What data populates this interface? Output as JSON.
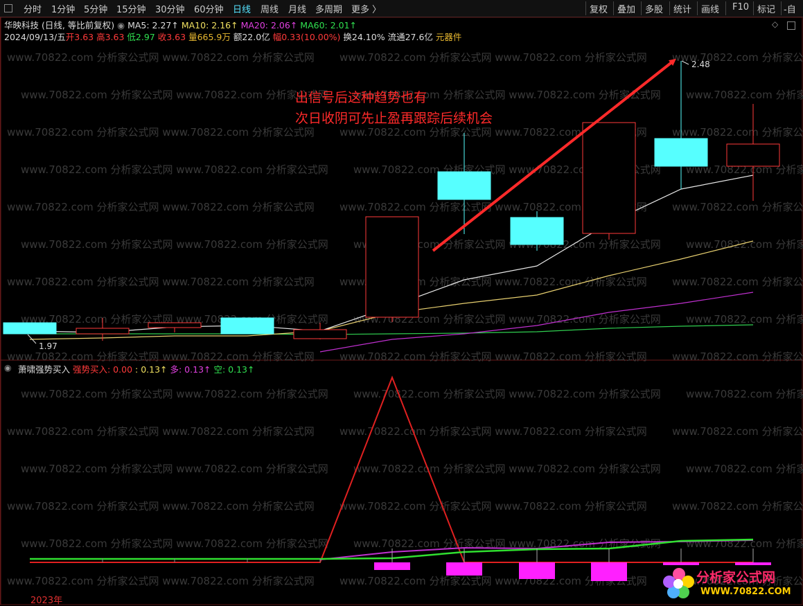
{
  "toolbar": {
    "periods": [
      "分时",
      "1分钟",
      "5分钟",
      "15分钟",
      "30分钟",
      "60分钟",
      "日线",
      "周线",
      "月线",
      "多周期",
      "更多 〉"
    ],
    "active": "日线",
    "right": [
      "复权",
      "叠加",
      "多股",
      "统计",
      "画线",
      "F10",
      "标记",
      "-自"
    ]
  },
  "header": {
    "stock": "华映科技 (日线, 等比前复权)",
    "ma5": "MA5: 2.27↑",
    "ma10": "MA10: 2.16↑",
    "ma20": "MA20: 2.06↑",
    "ma60": "MA60: 2.01↑",
    "date": "2024/09/13/五",
    "open": "开3.63",
    "high": "高3.63",
    "low": "低2.97",
    "close": "收3.63",
    "volume": "量665.9万",
    "amount": "额22.0亿",
    "change": "幅0.33(10.00%)",
    "turnover": "换24.10%",
    "float": "流通27.6亿",
    "sector": "元器件"
  },
  "annotation": {
    "line1": "出信号后这种趋势也有",
    "line2": "次日收阴可先止盈再跟踪后续机会"
  },
  "price_labels": {
    "high": "2.48",
    "low": "1.97"
  },
  "indicator": {
    "name": "萧啸强势买入",
    "signal": "强势买入: 0.00",
    "value1": ": 0.13↑",
    "bull": "多: 0.13↑",
    "bear": "空: 0.13↑"
  },
  "footer": {
    "year": "2023年"
  },
  "watermark": "www.70822.com 分析家公式网",
  "logo": {
    "name": "分析家公式网",
    "url": "WWW.70822.COM"
  },
  "colors": {
    "up": "#ff3a3a",
    "down": "#56ffff",
    "ma5": "#e8e8e8",
    "ma10": "#e8d070",
    "ma20": "#c030d0",
    "ma60": "#30d050"
  }
}
